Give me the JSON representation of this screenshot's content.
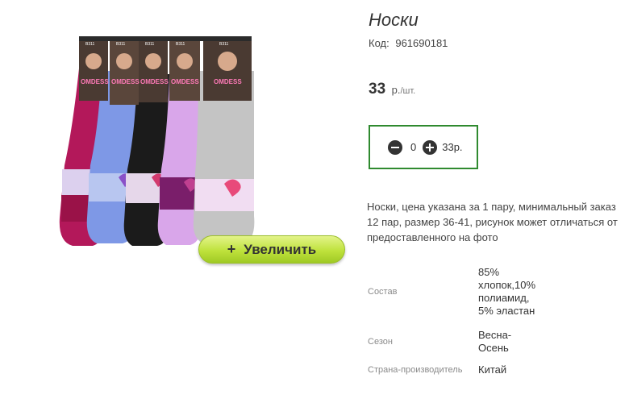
{
  "product": {
    "title": "Носки",
    "code_label": "Код:",
    "code": "961690181",
    "price": "33",
    "price_unit": "р.",
    "price_per": "/шт.",
    "description": "Носки, цена указана за 1 пару, минимальный заказ 12 пар, размер 36-41, рисунок может отличаться от предоставленного на фото",
    "zoom_button": {
      "icon": "plus-icon",
      "label": "Увеличить"
    },
    "cart": {
      "quantity": "0",
      "total": "33р."
    },
    "package_label": "OMDESS",
    "package_codes": [
      "B311",
      "B311",
      "B311",
      "B311",
      "B311"
    ],
    "properties": [
      {
        "name": "Состав",
        "value": "85% хлопок,10% полиамид, 5% эластан"
      },
      {
        "name": "Сезон",
        "value": "Весна-Осень"
      },
      {
        "name": "Страна-производитель",
        "value": "Китай"
      }
    ]
  },
  "colors": {
    "accent_green": "#2f8a2f",
    "button_green": "#bfe23c",
    "sock_colors": [
      "#b3185a",
      "#7e98e6",
      "#1b1b1b",
      "#d9a6ea",
      "#c4c4c4"
    ]
  }
}
